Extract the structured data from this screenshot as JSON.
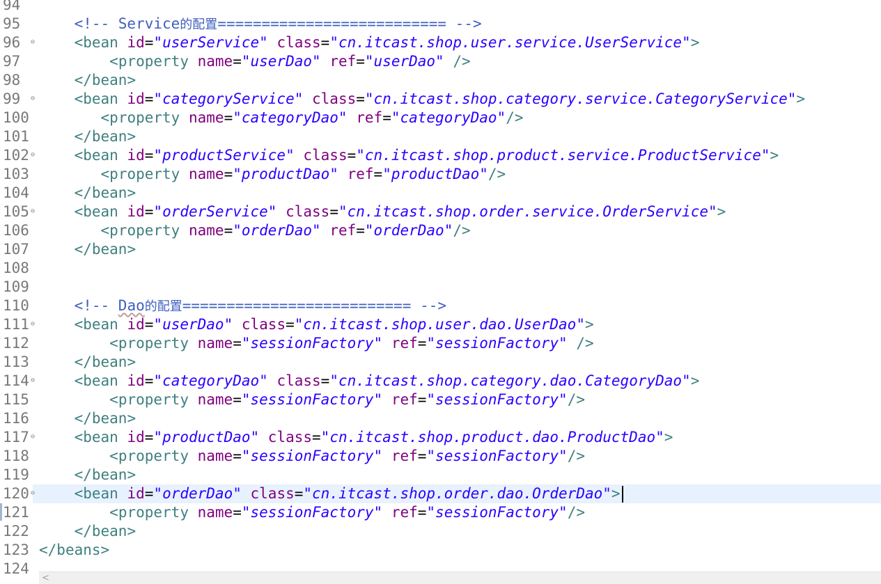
{
  "lines": [
    {
      "num": "94",
      "fold": "",
      "current": false,
      "tokens": []
    },
    {
      "num": "95",
      "fold": "",
      "current": false,
      "tokens": [
        {
          "t": "ws",
          "v": "    "
        },
        {
          "t": "cmt",
          "v": "<!-- Service"
        },
        {
          "t": "cmt-cjk",
          "v": "的配置"
        },
        {
          "t": "cmt",
          "v": "========================== -->"
        }
      ]
    },
    {
      "num": "96",
      "fold": "⊖",
      "current": false,
      "tokens": [
        {
          "t": "ws",
          "v": "    "
        },
        {
          "t": "tag",
          "v": "<"
        },
        {
          "t": "el",
          "v": "bean"
        },
        {
          "t": "ws",
          "v": " "
        },
        {
          "t": "attr",
          "v": "id"
        },
        {
          "t": "eq",
          "v": "="
        },
        {
          "t": "val",
          "v": "\"userService\""
        },
        {
          "t": "ws",
          "v": " "
        },
        {
          "t": "attr",
          "v": "class"
        },
        {
          "t": "eq",
          "v": "="
        },
        {
          "t": "val",
          "v": "\"cn.itcast.shop.user.service.UserService\""
        },
        {
          "t": "tag",
          "v": ">"
        }
      ]
    },
    {
      "num": "97",
      "fold": "",
      "current": false,
      "tokens": [
        {
          "t": "ws",
          "v": "        "
        },
        {
          "t": "tag",
          "v": "<"
        },
        {
          "t": "el",
          "v": "property"
        },
        {
          "t": "ws",
          "v": " "
        },
        {
          "t": "attr",
          "v": "name"
        },
        {
          "t": "eq",
          "v": "="
        },
        {
          "t": "val",
          "v": "\"userDao\""
        },
        {
          "t": "ws",
          "v": " "
        },
        {
          "t": "attr",
          "v": "ref"
        },
        {
          "t": "eq",
          "v": "="
        },
        {
          "t": "val",
          "v": "\"userDao\""
        },
        {
          "t": "ws",
          "v": " "
        },
        {
          "t": "tag",
          "v": "/>"
        }
      ]
    },
    {
      "num": "98",
      "fold": "",
      "current": false,
      "tokens": [
        {
          "t": "ws",
          "v": "    "
        },
        {
          "t": "tag",
          "v": "</"
        },
        {
          "t": "el",
          "v": "bean"
        },
        {
          "t": "tag",
          "v": ">"
        }
      ]
    },
    {
      "num": "99",
      "fold": "⊖",
      "current": false,
      "tokens": [
        {
          "t": "ws",
          "v": "    "
        },
        {
          "t": "tag",
          "v": "<"
        },
        {
          "t": "el",
          "v": "bean"
        },
        {
          "t": "ws",
          "v": " "
        },
        {
          "t": "attr",
          "v": "id"
        },
        {
          "t": "eq",
          "v": "="
        },
        {
          "t": "val",
          "v": "\"categoryService\""
        },
        {
          "t": "ws",
          "v": " "
        },
        {
          "t": "attr",
          "v": "class"
        },
        {
          "t": "eq",
          "v": "="
        },
        {
          "t": "val",
          "v": "\"cn.itcast.shop.category.service.CategoryService\""
        },
        {
          "t": "tag",
          "v": ">"
        }
      ]
    },
    {
      "num": "100",
      "fold": "",
      "current": false,
      "tokens": [
        {
          "t": "ws",
          "v": "       "
        },
        {
          "t": "tag",
          "v": "<"
        },
        {
          "t": "el",
          "v": "property"
        },
        {
          "t": "ws",
          "v": " "
        },
        {
          "t": "attr",
          "v": "name"
        },
        {
          "t": "eq",
          "v": "="
        },
        {
          "t": "val",
          "v": "\"categoryDao\""
        },
        {
          "t": "ws",
          "v": " "
        },
        {
          "t": "attr",
          "v": "ref"
        },
        {
          "t": "eq",
          "v": "="
        },
        {
          "t": "val",
          "v": "\"categoryDao\""
        },
        {
          "t": "tag",
          "v": "/>"
        }
      ]
    },
    {
      "num": "101",
      "fold": "",
      "current": false,
      "tokens": [
        {
          "t": "ws",
          "v": "    "
        },
        {
          "t": "tag",
          "v": "</"
        },
        {
          "t": "el",
          "v": "bean"
        },
        {
          "t": "tag",
          "v": ">"
        }
      ]
    },
    {
      "num": "102",
      "fold": "⊖",
      "current": false,
      "tokens": [
        {
          "t": "ws",
          "v": "    "
        },
        {
          "t": "tag",
          "v": "<"
        },
        {
          "t": "el",
          "v": "bean"
        },
        {
          "t": "ws",
          "v": " "
        },
        {
          "t": "attr",
          "v": "id"
        },
        {
          "t": "eq",
          "v": "="
        },
        {
          "t": "val",
          "v": "\"productService\""
        },
        {
          "t": "ws",
          "v": " "
        },
        {
          "t": "attr",
          "v": "class"
        },
        {
          "t": "eq",
          "v": "="
        },
        {
          "t": "val",
          "v": "\"cn.itcast.shop.product.service.ProductService\""
        },
        {
          "t": "tag",
          "v": ">"
        }
      ]
    },
    {
      "num": "103",
      "fold": "",
      "current": false,
      "tokens": [
        {
          "t": "ws",
          "v": "       "
        },
        {
          "t": "tag",
          "v": "<"
        },
        {
          "t": "el",
          "v": "property"
        },
        {
          "t": "ws",
          "v": " "
        },
        {
          "t": "attr",
          "v": "name"
        },
        {
          "t": "eq",
          "v": "="
        },
        {
          "t": "val",
          "v": "\"productDao\""
        },
        {
          "t": "ws",
          "v": " "
        },
        {
          "t": "attr",
          "v": "ref"
        },
        {
          "t": "eq",
          "v": "="
        },
        {
          "t": "val",
          "v": "\"productDao\""
        },
        {
          "t": "tag",
          "v": "/>"
        }
      ]
    },
    {
      "num": "104",
      "fold": "",
      "current": false,
      "tokens": [
        {
          "t": "ws",
          "v": "    "
        },
        {
          "t": "tag",
          "v": "</"
        },
        {
          "t": "el",
          "v": "bean"
        },
        {
          "t": "tag",
          "v": ">"
        }
      ]
    },
    {
      "num": "105",
      "fold": "⊖",
      "current": false,
      "tokens": [
        {
          "t": "ws",
          "v": "    "
        },
        {
          "t": "tag",
          "v": "<"
        },
        {
          "t": "el",
          "v": "bean"
        },
        {
          "t": "ws",
          "v": " "
        },
        {
          "t": "attr",
          "v": "id"
        },
        {
          "t": "eq",
          "v": "="
        },
        {
          "t": "val",
          "v": "\"orderService\""
        },
        {
          "t": "ws",
          "v": " "
        },
        {
          "t": "attr",
          "v": "class"
        },
        {
          "t": "eq",
          "v": "="
        },
        {
          "t": "val",
          "v": "\"cn.itcast.shop.order.service.OrderService\""
        },
        {
          "t": "tag",
          "v": ">"
        }
      ]
    },
    {
      "num": "106",
      "fold": "",
      "current": false,
      "tokens": [
        {
          "t": "ws",
          "v": "       "
        },
        {
          "t": "tag",
          "v": "<"
        },
        {
          "t": "el",
          "v": "property"
        },
        {
          "t": "ws",
          "v": " "
        },
        {
          "t": "attr",
          "v": "name"
        },
        {
          "t": "eq",
          "v": "="
        },
        {
          "t": "val",
          "v": "\"orderDao\""
        },
        {
          "t": "ws",
          "v": " "
        },
        {
          "t": "attr",
          "v": "ref"
        },
        {
          "t": "eq",
          "v": "="
        },
        {
          "t": "val",
          "v": "\"orderDao\""
        },
        {
          "t": "tag",
          "v": "/>"
        }
      ]
    },
    {
      "num": "107",
      "fold": "",
      "current": false,
      "tokens": [
        {
          "t": "ws",
          "v": "    "
        },
        {
          "t": "tag",
          "v": "</"
        },
        {
          "t": "el",
          "v": "bean"
        },
        {
          "t": "tag",
          "v": ">"
        }
      ]
    },
    {
      "num": "108",
      "fold": "",
      "current": false,
      "tokens": []
    },
    {
      "num": "109",
      "fold": "",
      "current": false,
      "tokens": []
    },
    {
      "num": "110",
      "fold": "",
      "current": false,
      "tokens": [
        {
          "t": "ws",
          "v": "    "
        },
        {
          "t": "cmt",
          "v": "<!-- "
        },
        {
          "t": "cmt-sq",
          "v": "Dao"
        },
        {
          "t": "cmt-cjk",
          "v": "的配置"
        },
        {
          "t": "cmt",
          "v": "========================== -->"
        }
      ]
    },
    {
      "num": "111",
      "fold": "⊖",
      "current": false,
      "tokens": [
        {
          "t": "ws",
          "v": "    "
        },
        {
          "t": "tag",
          "v": "<"
        },
        {
          "t": "el",
          "v": "bean"
        },
        {
          "t": "ws",
          "v": " "
        },
        {
          "t": "attr",
          "v": "id"
        },
        {
          "t": "eq",
          "v": "="
        },
        {
          "t": "val",
          "v": "\"userDao\""
        },
        {
          "t": "ws",
          "v": " "
        },
        {
          "t": "attr",
          "v": "class"
        },
        {
          "t": "eq",
          "v": "="
        },
        {
          "t": "val",
          "v": "\"cn.itcast.shop.user.dao.UserDao\""
        },
        {
          "t": "tag",
          "v": ">"
        }
      ]
    },
    {
      "num": "112",
      "fold": "",
      "current": false,
      "tokens": [
        {
          "t": "ws",
          "v": "        "
        },
        {
          "t": "tag",
          "v": "<"
        },
        {
          "t": "el",
          "v": "property"
        },
        {
          "t": "ws",
          "v": " "
        },
        {
          "t": "attr",
          "v": "name"
        },
        {
          "t": "eq",
          "v": "="
        },
        {
          "t": "val",
          "v": "\"sessionFactory\""
        },
        {
          "t": "ws",
          "v": " "
        },
        {
          "t": "attr",
          "v": "ref"
        },
        {
          "t": "eq",
          "v": "="
        },
        {
          "t": "val",
          "v": "\"sessionFactory\""
        },
        {
          "t": "ws",
          "v": " "
        },
        {
          "t": "tag",
          "v": "/>"
        }
      ]
    },
    {
      "num": "113",
      "fold": "",
      "current": false,
      "tokens": [
        {
          "t": "ws",
          "v": "    "
        },
        {
          "t": "tag",
          "v": "</"
        },
        {
          "t": "el",
          "v": "bean"
        },
        {
          "t": "tag",
          "v": ">"
        }
      ]
    },
    {
      "num": "114",
      "fold": "⊖",
      "current": false,
      "tokens": [
        {
          "t": "ws",
          "v": "    "
        },
        {
          "t": "tag",
          "v": "<"
        },
        {
          "t": "el",
          "v": "bean"
        },
        {
          "t": "ws",
          "v": " "
        },
        {
          "t": "attr",
          "v": "id"
        },
        {
          "t": "eq",
          "v": "="
        },
        {
          "t": "val",
          "v": "\"categoryDao\""
        },
        {
          "t": "ws",
          "v": " "
        },
        {
          "t": "attr",
          "v": "class"
        },
        {
          "t": "eq",
          "v": "="
        },
        {
          "t": "val",
          "v": "\"cn.itcast.shop.category.dao.CategoryDao\""
        },
        {
          "t": "tag",
          "v": ">"
        }
      ]
    },
    {
      "num": "115",
      "fold": "",
      "current": false,
      "tokens": [
        {
          "t": "ws",
          "v": "        "
        },
        {
          "t": "tag",
          "v": "<"
        },
        {
          "t": "el",
          "v": "property"
        },
        {
          "t": "ws",
          "v": " "
        },
        {
          "t": "attr",
          "v": "name"
        },
        {
          "t": "eq",
          "v": "="
        },
        {
          "t": "val",
          "v": "\"sessionFactory\""
        },
        {
          "t": "ws",
          "v": " "
        },
        {
          "t": "attr",
          "v": "ref"
        },
        {
          "t": "eq",
          "v": "="
        },
        {
          "t": "val",
          "v": "\"sessionFactory\""
        },
        {
          "t": "tag",
          "v": "/>"
        }
      ]
    },
    {
      "num": "116",
      "fold": "",
      "current": false,
      "tokens": [
        {
          "t": "ws",
          "v": "    "
        },
        {
          "t": "tag",
          "v": "</"
        },
        {
          "t": "el",
          "v": "bean"
        },
        {
          "t": "tag",
          "v": ">"
        }
      ]
    },
    {
      "num": "117",
      "fold": "⊖",
      "current": false,
      "tokens": [
        {
          "t": "ws",
          "v": "    "
        },
        {
          "t": "tag",
          "v": "<"
        },
        {
          "t": "el",
          "v": "bean"
        },
        {
          "t": "ws",
          "v": " "
        },
        {
          "t": "attr",
          "v": "id"
        },
        {
          "t": "eq",
          "v": "="
        },
        {
          "t": "val",
          "v": "\"productDao\""
        },
        {
          "t": "ws",
          "v": " "
        },
        {
          "t": "attr",
          "v": "class"
        },
        {
          "t": "eq",
          "v": "="
        },
        {
          "t": "val",
          "v": "\"cn.itcast.shop.product.dao.ProductDao\""
        },
        {
          "t": "tag",
          "v": ">"
        }
      ]
    },
    {
      "num": "118",
      "fold": "",
      "current": false,
      "tokens": [
        {
          "t": "ws",
          "v": "        "
        },
        {
          "t": "tag",
          "v": "<"
        },
        {
          "t": "el",
          "v": "property"
        },
        {
          "t": "ws",
          "v": " "
        },
        {
          "t": "attr",
          "v": "name"
        },
        {
          "t": "eq",
          "v": "="
        },
        {
          "t": "val",
          "v": "\"sessionFactory\""
        },
        {
          "t": "ws",
          "v": " "
        },
        {
          "t": "attr",
          "v": "ref"
        },
        {
          "t": "eq",
          "v": "="
        },
        {
          "t": "val",
          "v": "\"sessionFactory\""
        },
        {
          "t": "tag",
          "v": "/>"
        }
      ]
    },
    {
      "num": "119",
      "fold": "",
      "current": false,
      "tokens": [
        {
          "t": "ws",
          "v": "    "
        },
        {
          "t": "tag",
          "v": "</"
        },
        {
          "t": "el",
          "v": "bean"
        },
        {
          "t": "tag",
          "v": ">"
        }
      ]
    },
    {
      "num": "120",
      "fold": "⊖",
      "current": true,
      "tokens": [
        {
          "t": "ws",
          "v": "    "
        },
        {
          "t": "tag",
          "v": "<"
        },
        {
          "t": "el",
          "v": "bean"
        },
        {
          "t": "ws",
          "v": " "
        },
        {
          "t": "attr",
          "v": "id"
        },
        {
          "t": "eq",
          "v": "="
        },
        {
          "t": "val",
          "v": "\"orderDao\""
        },
        {
          "t": "ws",
          "v": " "
        },
        {
          "t": "attr",
          "v": "class"
        },
        {
          "t": "eq",
          "v": "="
        },
        {
          "t": "val",
          "v": "\"cn.itcast.shop.order.dao.OrderDao\""
        },
        {
          "t": "tag",
          "v": ">"
        },
        {
          "t": "caret",
          "v": ""
        }
      ]
    },
    {
      "num": "121",
      "fold": "",
      "current": false,
      "tokens": [
        {
          "t": "ws",
          "v": "        "
        },
        {
          "t": "tag",
          "v": "<"
        },
        {
          "t": "el",
          "v": "property"
        },
        {
          "t": "ws",
          "v": " "
        },
        {
          "t": "attr",
          "v": "name"
        },
        {
          "t": "eq",
          "v": "="
        },
        {
          "t": "val",
          "v": "\"sessionFactory\""
        },
        {
          "t": "ws",
          "v": " "
        },
        {
          "t": "attr",
          "v": "ref"
        },
        {
          "t": "eq",
          "v": "="
        },
        {
          "t": "val",
          "v": "\"sessionFactory\""
        },
        {
          "t": "tag",
          "v": "/>"
        }
      ]
    },
    {
      "num": "122",
      "fold": "",
      "current": false,
      "tokens": [
        {
          "t": "ws",
          "v": "    "
        },
        {
          "t": "tag",
          "v": "</"
        },
        {
          "t": "el",
          "v": "bean"
        },
        {
          "t": "tag",
          "v": ">"
        }
      ]
    },
    {
      "num": "123",
      "fold": "",
      "current": false,
      "tokens": [
        {
          "t": "tag",
          "v": "</"
        },
        {
          "t": "el",
          "v": "beans"
        },
        {
          "t": "tag",
          "v": ">"
        }
      ]
    },
    {
      "num": "124",
      "fold": "",
      "current": false,
      "tokens": []
    }
  ],
  "scrollbar": {
    "left_arrow": "<"
  },
  "colors": {
    "tag": "#3f7f7f",
    "attribute": "#7f007f",
    "value": "#2a00ff",
    "comment": "#3f5fbf",
    "line_number": "#787878",
    "current_line": "#e8f2fe"
  }
}
